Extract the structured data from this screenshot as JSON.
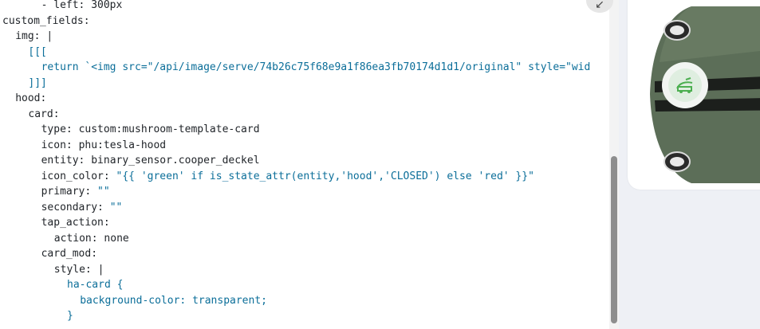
{
  "editor": {
    "lines": [
      {
        "indent": 3,
        "parts": [
          {
            "text": "- left: 300px",
            "c": "k"
          }
        ]
      },
      {
        "indent": 0,
        "parts": [
          {
            "text": "custom_fields:",
            "c": "k"
          }
        ]
      },
      {
        "indent": 1,
        "parts": [
          {
            "text": "img: ",
            "c": "k"
          },
          {
            "text": "|",
            "c": "k"
          }
        ]
      },
      {
        "indent": 2,
        "parts": [
          {
            "text": "[[[",
            "c": "s"
          }
        ]
      },
      {
        "indent": 3,
        "parts": [
          {
            "text": "return `<img src=\"/api/image/serve/74b26c75f68e9a1f86ea3fb70174d1d1/original\" style=\"wid",
            "c": "s"
          }
        ]
      },
      {
        "indent": 2,
        "parts": [
          {
            "text": "]]]",
            "c": "s"
          }
        ]
      },
      {
        "indent": 1,
        "parts": [
          {
            "text": "hood:",
            "c": "k"
          }
        ]
      },
      {
        "indent": 2,
        "parts": [
          {
            "text": "card:",
            "c": "k"
          }
        ]
      },
      {
        "indent": 3,
        "parts": [
          {
            "text": "type: ",
            "c": "k"
          },
          {
            "text": "custom:mushroom-template-card",
            "c": "k"
          }
        ]
      },
      {
        "indent": 3,
        "parts": [
          {
            "text": "icon: ",
            "c": "k"
          },
          {
            "text": "phu:tesla-hood",
            "c": "k"
          }
        ]
      },
      {
        "indent": 3,
        "parts": [
          {
            "text": "entity: ",
            "c": "k"
          },
          {
            "text": "binary_sensor.cooper_deckel",
            "c": "k"
          }
        ]
      },
      {
        "indent": 3,
        "parts": [
          {
            "text": "icon_color: ",
            "c": "k"
          },
          {
            "text": "\"{{ 'green' if is_state_attr(entity,'hood','CLOSED') else 'red' }}\"",
            "c": "s"
          }
        ]
      },
      {
        "indent": 3,
        "parts": [
          {
            "text": "primary: ",
            "c": "k"
          },
          {
            "text": "\"\"",
            "c": "s"
          }
        ]
      },
      {
        "indent": 3,
        "parts": [
          {
            "text": "secondary: ",
            "c": "k"
          },
          {
            "text": "\"\"",
            "c": "s"
          }
        ]
      },
      {
        "indent": 3,
        "parts": [
          {
            "text": "tap_action:",
            "c": "k"
          }
        ]
      },
      {
        "indent": 4,
        "parts": [
          {
            "text": "action: ",
            "c": "k"
          },
          {
            "text": "none",
            "c": "k"
          }
        ]
      },
      {
        "indent": 3,
        "parts": [
          {
            "text": "card_mod:",
            "c": "k"
          }
        ]
      },
      {
        "indent": 4,
        "parts": [
          {
            "text": "style: ",
            "c": "k"
          },
          {
            "text": "|",
            "c": "k"
          }
        ]
      },
      {
        "indent": 5,
        "parts": [
          {
            "text": "ha-card {",
            "c": "s"
          }
        ]
      },
      {
        "indent": 6,
        "parts": [
          {
            "text": "background-color: transparent;",
            "c": "s"
          }
        ]
      },
      {
        "indent": 5,
        "parts": [
          {
            "text": "}",
            "c": "s"
          }
        ]
      }
    ]
  },
  "toolbar": {
    "collapse_icon": "collapse-arrow-icon",
    "collapse_glyph": "↙"
  },
  "preview": {
    "hood_icon": "tesla-hood-icon",
    "hood_icon_color": "#4caf50",
    "car_body_color": "#5c6e58",
    "car_stripe_color": "#1c1f1c"
  }
}
